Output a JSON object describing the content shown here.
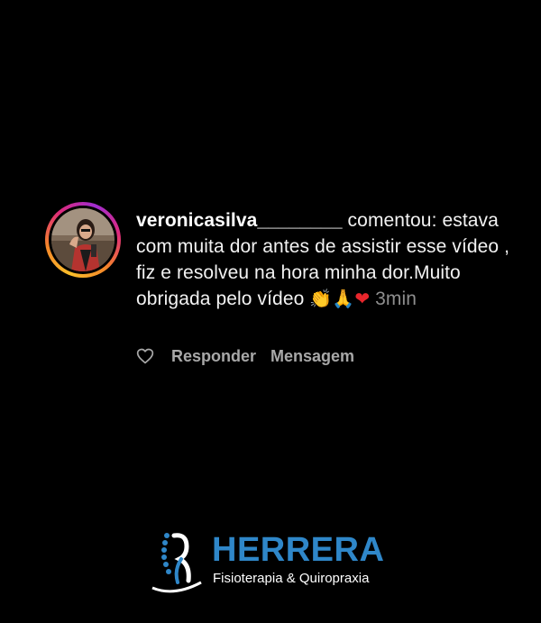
{
  "comment": {
    "username": "veronicasilva________",
    "action": " comentou:",
    "text": "estava com muita dor antes de assistir esse vídeo , fiz e resolveu na hora minha dor.Muito obrigada pelo vídeo",
    "emojis": {
      "clap": "👏",
      "pray": "🙏",
      "heart": "❤"
    },
    "time": "3min"
  },
  "actions": {
    "reply_label": "Responder",
    "message_label": "Mensagem"
  },
  "logo": {
    "title": "HERRERA",
    "subtitle": "Fisioterapia & Quiropraxia"
  },
  "icons": {
    "like": "heart-outline-icon",
    "avatar": "user-avatar"
  },
  "colors": {
    "background": "#000000",
    "secondary_text": "#a8a8a8",
    "brand_blue": "#2f87c9"
  }
}
